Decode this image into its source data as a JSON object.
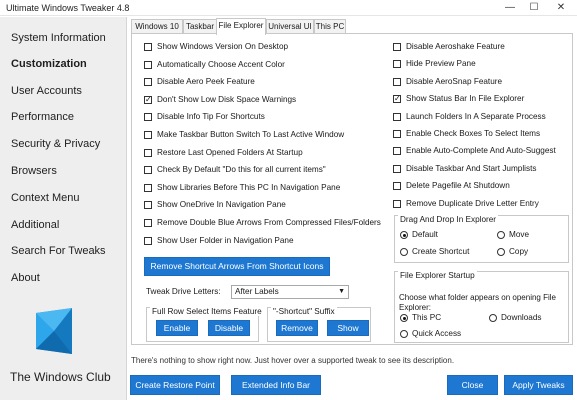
{
  "window": {
    "title": "Ultimate Windows Tweaker 4.8",
    "minimize": "—",
    "maximize": "☐",
    "close": "✕"
  },
  "sidebar": {
    "items": [
      {
        "label": "System Information"
      },
      {
        "label": "Customization"
      },
      {
        "label": "User Accounts"
      },
      {
        "label": "Performance"
      },
      {
        "label": "Security & Privacy"
      },
      {
        "label": "Browsers"
      },
      {
        "label": "Context Menu"
      },
      {
        "label": "Additional"
      },
      {
        "label": "Search For Tweaks"
      },
      {
        "label": "About"
      }
    ],
    "active": "Customization",
    "brand": "The Windows Club",
    "logo_icon": "windows-logo-icon"
  },
  "tabs": [
    {
      "label": "Windows 10"
    },
    {
      "label": "Taskbar"
    },
    {
      "label": "File Explorer"
    },
    {
      "label": "Universal UI"
    },
    {
      "label": "This PC"
    }
  ],
  "active_tab": "File Explorer",
  "left_options": [
    {
      "label": "Show Windows Version On Desktop",
      "checked": false
    },
    {
      "label": "Automatically Choose Accent Color",
      "checked": false
    },
    {
      "label": "Disable Aero Peek Feature",
      "checked": false
    },
    {
      "label": "Don't Show Low Disk Space Warnings",
      "checked": true
    },
    {
      "label": "Disable Info Tip For Shortcuts",
      "checked": false
    },
    {
      "label": "Make Taskbar Button Switch To Last Active Window",
      "checked": false
    },
    {
      "label": "Restore Last Opened Folders At Startup",
      "checked": false
    },
    {
      "label": "Check By Default \"Do this for all current items\"",
      "checked": false
    },
    {
      "label": "Show Libraries Before This PC In Navigation Pane",
      "checked": false
    },
    {
      "label": "Show OneDrive In Navigation Pane",
      "checked": false
    },
    {
      "label": "Remove Double Blue Arrows From Compressed Files/Folders",
      "checked": false
    },
    {
      "label": "Show User Folder in Navigation Pane",
      "checked": false
    }
  ],
  "right_options": [
    {
      "label": "Disable Aeroshake Feature",
      "checked": false
    },
    {
      "label": "Hide Preview Pane",
      "checked": false
    },
    {
      "label": "Disable AeroSnap Feature",
      "checked": false
    },
    {
      "label": "Show Status Bar In File Explorer",
      "checked": true
    },
    {
      "label": "Launch Folders In A Separate Process",
      "checked": false
    },
    {
      "label": "Enable Check Boxes To Select Items",
      "checked": false
    },
    {
      "label": "Enable Auto-Complete And Auto-Suggest",
      "checked": false
    },
    {
      "label": "Disable Taskbar And Start Jumplists",
      "checked": false
    },
    {
      "label": "Delete Pagefile At Shutdown",
      "checked": false
    },
    {
      "label": "Remove Duplicate Drive Letter Entry",
      "checked": false
    }
  ],
  "remove_arrows_button": "Remove Shortcut Arrows From Shortcut Icons",
  "drive_letters": {
    "label": "Tweak Drive Letters:",
    "value": "After Labels"
  },
  "full_row": {
    "title": "Full Row Select Items Feature",
    "enable": "Enable",
    "disable": "Disable"
  },
  "shortcut_suffix": {
    "title": "\"-Shortcut\" Suffix",
    "remove": "Remove",
    "show": "Show"
  },
  "drag_drop": {
    "title": "Drag And Drop In Explorer",
    "options": [
      {
        "label": "Default",
        "checked": true
      },
      {
        "label": "Move",
        "checked": false
      },
      {
        "label": "Create Shortcut",
        "checked": false
      },
      {
        "label": "Copy",
        "checked": false
      }
    ]
  },
  "startup": {
    "title": "File Explorer Startup",
    "description": "Choose what folder appears on opening File Explorer:",
    "options": [
      {
        "label": "This PC",
        "checked": true
      },
      {
        "label": "Downloads",
        "checked": false
      },
      {
        "label": "Quick Access",
        "checked": false
      }
    ]
  },
  "info_bar": "There's nothing to show right now. Just hover over a supported tweak to see its description.",
  "bottom_buttons": {
    "restore_point": "Create Restore Point",
    "extended_info": "Extended Info Bar",
    "close": "Close",
    "apply": "Apply Tweaks"
  },
  "colors": {
    "accent": "#1e78d2",
    "sidebar_bg": "#eeeeee",
    "logo_blue": "#1c8fd8"
  }
}
